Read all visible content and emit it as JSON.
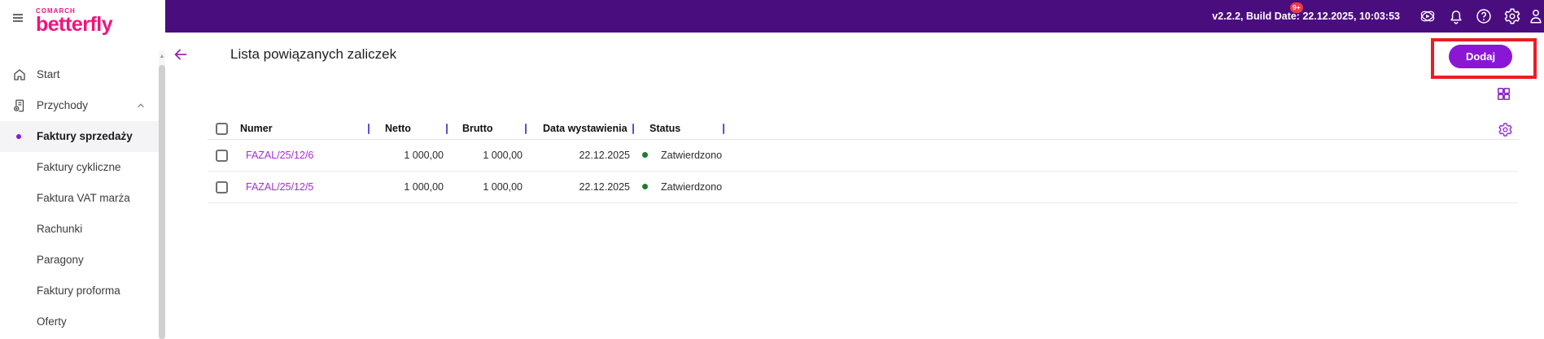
{
  "brand": {
    "company": "COMARCH",
    "product": "betterfly"
  },
  "topbar": {
    "version_text": "v2.2.2, Build Date: 22.12.2025, 10:03:53",
    "notification_badge": "9+",
    "icons": [
      "orbit-icon",
      "bell-icon",
      "help-icon",
      "gear-icon",
      "profile-icon"
    ]
  },
  "sidebar": {
    "scrollbar": "vertical",
    "items": [
      {
        "label": "Start",
        "icon": "home-icon",
        "active": false
      },
      {
        "label": "Przychody",
        "icon": "income-document-icon",
        "expanded": true,
        "active": false
      },
      {
        "label": "Faktury sprzedaży",
        "active": true
      },
      {
        "label": "Faktury cykliczne",
        "active": false
      },
      {
        "label": "Faktura VAT marża",
        "active": false
      },
      {
        "label": "Rachunki",
        "active": false
      },
      {
        "label": "Paragony",
        "active": false
      },
      {
        "label": "Faktury proforma",
        "active": false
      },
      {
        "label": "Oferty",
        "active": false
      }
    ]
  },
  "main": {
    "title": "Lista powiązanych zaliczek",
    "add_button_label": "Dodaj",
    "toolbar_icons": [
      "widgets-grid-icon",
      "table-settings-gear-icon"
    ],
    "table": {
      "columns": [
        "Numer",
        "Netto",
        "Brutto",
        "Data wystawienia",
        "Status"
      ],
      "rows": [
        {
          "numer": "FAZAL/25/12/6",
          "netto": "1 000,00",
          "brutto": "1 000,00",
          "data_wystawienia": "22.12.2025",
          "status": "Zatwierdzono"
        },
        {
          "numer": "FAZAL/25/12/5",
          "netto": "1 000,00",
          "brutto": "1 000,00",
          "data_wystawienia": "22.12.2025",
          "status": "Zatwierdzono"
        }
      ]
    }
  },
  "colors": {
    "topbar_bg": "#4a0d7e",
    "accent_purple": "#8a17d6",
    "link_purple": "#a32cd6",
    "logo_pink": "#f3127c",
    "status_green": "#1e7d32",
    "badge_red": "#ef3945",
    "annotation_red": "#ec1c24",
    "column_separator": "#5055cc"
  }
}
